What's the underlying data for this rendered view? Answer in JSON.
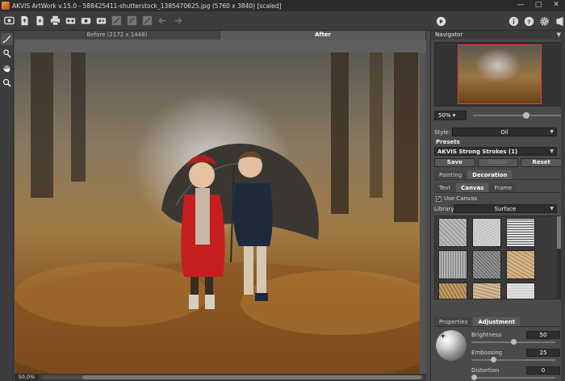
{
  "window": {
    "title": "AKVIS ArtWork v.15.0 - 588425411-shutterstock_1385470625.jpg (5760 x 3840) [scaled]"
  },
  "view_tabs": {
    "before": "Before (2172 x 1448)",
    "after": "After"
  },
  "status": {
    "zoom": "50,0%"
  },
  "navigator": {
    "title": "Navigator",
    "zoom": "50%",
    "zoom_level": 0.62
  },
  "style": {
    "label": "Style:",
    "value": "Oil"
  },
  "presets": {
    "title": "Presets",
    "selected": "AKVIS Strong Strokes (1)",
    "save": "Save",
    "delete": "Delete",
    "reset": "Reset"
  },
  "main_tabs": [
    "Painting",
    "Decoration"
  ],
  "decoration_tabs": [
    "Text",
    "Canvas",
    "Frame"
  ],
  "canvas": {
    "use_canvas_label": "Use Canvas",
    "use_canvas_checked": true,
    "library_label": "Library",
    "library_value": "Surface"
  },
  "bottom_tabs": [
    "Properties",
    "Adjustment"
  ],
  "adjustment": {
    "brightness": {
      "label": "Brightness",
      "value": "50",
      "level": 0.5
    },
    "embossing": {
      "label": "Embossing",
      "value": "25",
      "level": 0.25
    },
    "distortion": {
      "label": "Distortion",
      "value": "0",
      "level": 0.0
    }
  },
  "icons": {
    "toolbar": [
      "open-icon",
      "save-icon",
      "export-icon",
      "print-icon",
      "batch-icon",
      "plugin-icon",
      "share-icon",
      "undo-icon",
      "redo-icon",
      "run-icon",
      "info-icon",
      "help-icon",
      "settings-icon",
      "news-icon"
    ],
    "tools": [
      "brush-icon",
      "eraser-icon",
      "hand-icon",
      "zoom-icon"
    ]
  }
}
